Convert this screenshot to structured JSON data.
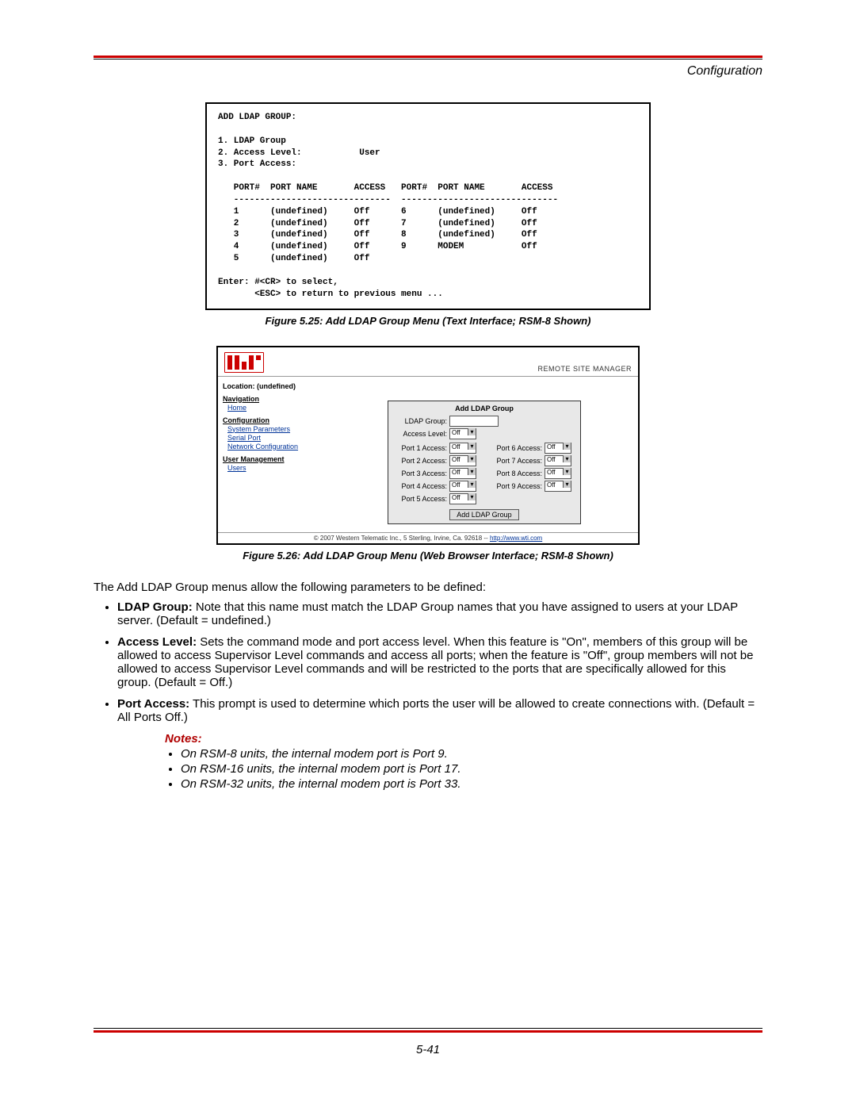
{
  "header": {
    "section_title": "Configuration"
  },
  "terminal": {
    "title": "ADD LDAP GROUP:",
    "items": [
      "1. LDAP Group",
      "2. Access Level:           User",
      "3. Port Access:"
    ],
    "col_headers": "   PORT#  PORT NAME       ACCESS   PORT#  PORT NAME       ACCESS",
    "divider": "   ------------------------------  ------------------------------",
    "rows": [
      "   1      (undefined)     Off      6      (undefined)     Off",
      "   2      (undefined)     Off      7      (undefined)     Off",
      "   3      (undefined)     Off      8      (undefined)     Off",
      "   4      (undefined)     Off      9      MODEM           Off",
      "   5      (undefined)     Off"
    ],
    "enter_line1": "Enter: #<CR> to select,",
    "enter_line2": "       <ESC> to return to previous menu ..."
  },
  "fig525": "Figure 5.25:  Add LDAP Group Menu (Text Interface; RSM-8 Shown)",
  "web": {
    "product": "REMOTE SITE MANAGER",
    "location": "Location: (undefined)",
    "nav_heading": "Navigation",
    "home": "Home",
    "config_heading": "Configuration",
    "nav_links": {
      "system": "System Parameters",
      "serial": "Serial Port",
      "network": "Network Configuration"
    },
    "user_mgmt_heading": "User Management",
    "users_link": "Users",
    "form": {
      "title": "Add LDAP Group",
      "ldap_group_label": "LDAP Group:",
      "access_level_label": "Access Level:",
      "access_level_value": "Off",
      "ports_left": [
        {
          "label": "Port 1 Access:",
          "value": "Off"
        },
        {
          "label": "Port 2 Access:",
          "value": "Off"
        },
        {
          "label": "Port 3 Access:",
          "value": "Off"
        },
        {
          "label": "Port 4 Access:",
          "value": "Off"
        },
        {
          "label": "Port 5 Access:",
          "value": "Off"
        }
      ],
      "ports_right": [
        {
          "label": "Port 6 Access:",
          "value": "Off"
        },
        {
          "label": "Port 7 Access:",
          "value": "Off"
        },
        {
          "label": "Port 8 Access:",
          "value": "Off"
        },
        {
          "label": "Port 9 Access:",
          "value": "Off"
        }
      ],
      "button": "Add LDAP Group"
    },
    "footer_text": "© 2007 Western Telematic Inc., 5 Sterling, Irvine, Ca. 92618 -- ",
    "footer_link": "http://www.wti.com"
  },
  "fig526": "Figure 5.26:  Add LDAP Group Menu (Web Browser Interface; RSM-8 Shown)",
  "para_intro": "The Add LDAP Group menus allow the following parameters to be defined:",
  "bullets": {
    "b1_bold": "LDAP Group:",
    "b1_rest": "  Note that this name must match the LDAP Group names that you have assigned to users at your LDAP server.  (Default = undefined.)",
    "b2_bold": "Access Level:",
    "b2_rest": "  Sets the command mode and port access level.  When this feature is \"On\", members of this group will be allowed to access Supervisor Level commands and access all ports; when the feature is \"Off\", group members will not be allowed to access Supervisor Level commands and will be restricted to the ports that are specifically allowed for this group.  (Default = Off.)",
    "b3_bold": "Port Access:",
    "b3_rest": "  This prompt is used to determine which ports the user will be allowed to create connections with.  (Default = All Ports Off.)"
  },
  "notes": {
    "title": "Notes:",
    "items": [
      "On RSM-8 units, the internal modem port is Port 9.",
      "On RSM-16 units, the internal modem port is Port 17.",
      "On RSM-32 units, the internal modem port is Port 33."
    ]
  },
  "page_number": "5-41"
}
